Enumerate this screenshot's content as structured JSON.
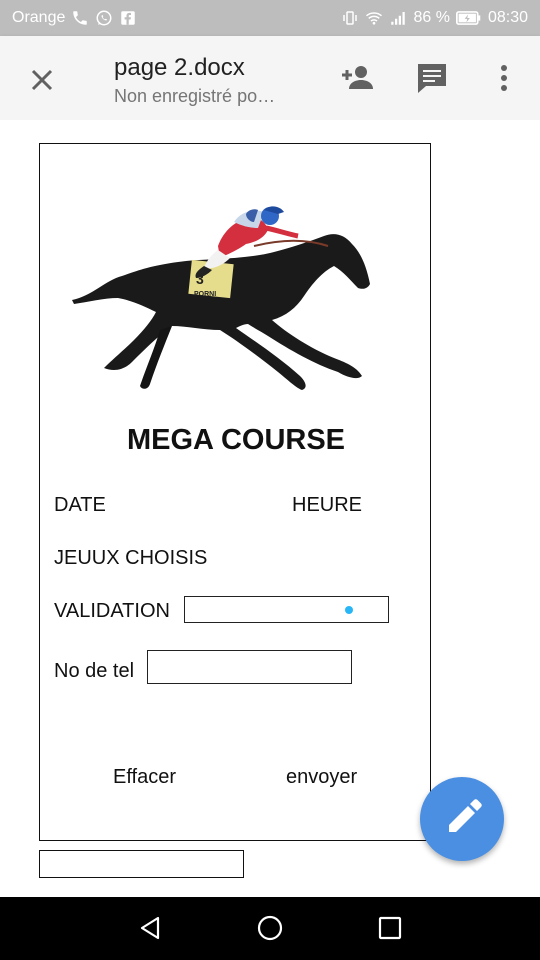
{
  "status_bar": {
    "carrier": "Orange",
    "battery_percent": "86 %",
    "time": "08:30"
  },
  "app_bar": {
    "title": "page 2.docx",
    "subtitle": "Non enregistré po…"
  },
  "form": {
    "title": "MEGA COURSE",
    "date_label": "DATE",
    "heure_label": "HEURE",
    "jeux_label": "JEUUX CHOISIS",
    "validation_label": "VALIDATION",
    "validation_value": "",
    "tel_label": "No de tel",
    "tel_value": "",
    "clear_label": "Effacer",
    "send_label": "envoyer",
    "saddle_number": "3",
    "saddle_text": "PORNI"
  },
  "colors": {
    "fab": "#4a8fe2",
    "status_bar": "#bdbdbd",
    "app_bar": "#f5f5f5",
    "cursor": "#29b6f6"
  },
  "icons": {
    "close": "close-icon",
    "add_person": "add-person-icon",
    "comment": "comment-icon",
    "more": "more-vert-icon",
    "edit": "pencil-icon",
    "nav_back": "back-triangle-icon",
    "nav_home": "home-circle-icon",
    "nav_recents": "recents-square-icon"
  }
}
